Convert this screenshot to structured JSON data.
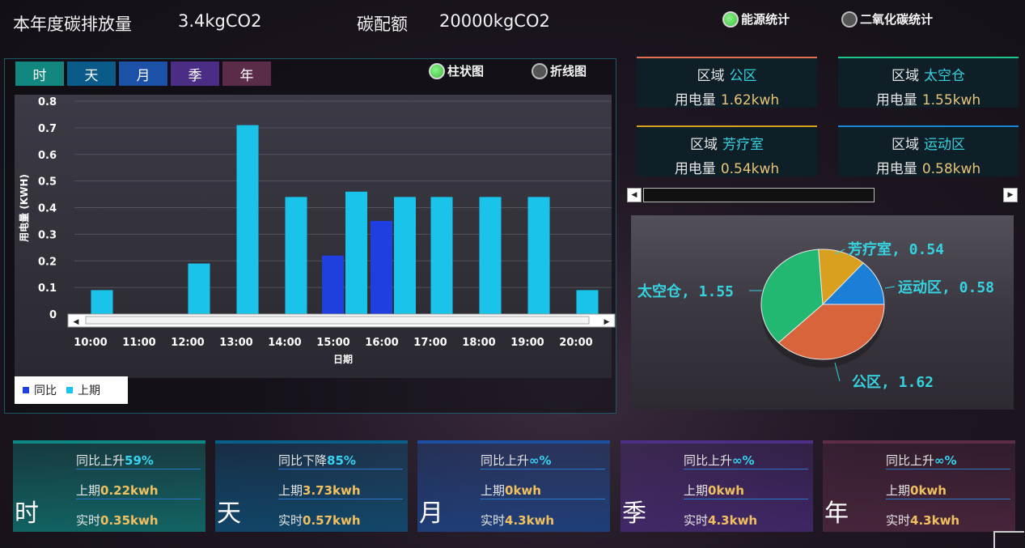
{
  "header": {
    "annual_label": "本年度碳排放量",
    "annual_value": "3.4kgCO2",
    "quota_label": "碳配额",
    "quota_value": "20000kgCO2",
    "radio_energy": "能源统计",
    "radio_co2": "二氧化碳统计"
  },
  "tabs": [
    {
      "label": "时",
      "color": "#12877f"
    },
    {
      "label": "天",
      "color": "#0a5a8a"
    },
    {
      "label": "月",
      "color": "#1b52a8"
    },
    {
      "label": "季",
      "color": "#4b2d85"
    },
    {
      "label": "年",
      "color": "#5a2c47"
    }
  ],
  "chart_type_toggle": {
    "bar": "柱状图",
    "line": "折线图"
  },
  "chart_data": {
    "type": "bar",
    "categories": [
      "10:00",
      "11:00",
      "12:00",
      "13:00",
      "14:00",
      "15:00",
      "16:00",
      "17:00",
      "18:00",
      "19:00",
      "20:00"
    ],
    "series": [
      {
        "name": "同比",
        "color": "#1f3fe0",
        "values": [
          null,
          null,
          null,
          null,
          null,
          0.22,
          0.35,
          null,
          null,
          null,
          null
        ]
      },
      {
        "name": "上期",
        "color": "#19c3ea",
        "values": [
          0.09,
          0,
          0.19,
          0.71,
          0.44,
          0.46,
          0.44,
          0.44,
          0.44,
          0.44,
          0.09
        ]
      }
    ],
    "yticks": [
      "0",
      "0.1",
      "0.2",
      "0.3",
      "0.4",
      "0.5",
      "0.6",
      "0.7",
      "0.8"
    ],
    "ylim": [
      0,
      0.8
    ],
    "xlabel": "日期",
    "ylabel": "用电量 (KWH)",
    "grid": true,
    "legend_position": "bottom-left"
  },
  "regions": [
    {
      "area_label": "区域",
      "area": "公区",
      "usage_label": "用电量",
      "usage": "1.62kwh",
      "color": "#e07050"
    },
    {
      "area_label": "区域",
      "area": "太空仓",
      "usage_label": "用电量",
      "usage": "1.55kwh",
      "color": "#1ec48a"
    },
    {
      "area_label": "区域",
      "area": "芳疗室",
      "usage_label": "用电量",
      "usage": "0.54kwh",
      "color": "#d9a020"
    },
    {
      "area_label": "区域",
      "area": "运动区",
      "usage_label": "用电量",
      "usage": "0.58kwh",
      "color": "#1b86d8"
    }
  ],
  "pie": {
    "slices": [
      {
        "name": "公区",
        "value": 1.62,
        "color": "#d8643c",
        "label": "公区, 1.62"
      },
      {
        "name": "太空仓",
        "value": 1.55,
        "color": "#23b872",
        "label": "太空仓, 1.55"
      },
      {
        "name": "芳疗室",
        "value": 0.54,
        "color": "#d9a020",
        "label": "芳疗室, 0.54"
      },
      {
        "name": "运动区",
        "value": 0.58,
        "color": "#1b7fd8",
        "label": "运动区, 0.58"
      }
    ]
  },
  "summary": [
    {
      "period": "时",
      "trend": "同比上升",
      "pct": "59%",
      "prev_label": "上期",
      "prev": "0.22kwh",
      "real_label": "实时",
      "real": "0.35kwh",
      "color": "#0e8a86"
    },
    {
      "period": "天",
      "trend": "同比下降",
      "pct": "85%",
      "prev_label": "上期",
      "prev": "3.73kwh",
      "real_label": "实时",
      "real": "0.57kwh",
      "color": "#0b5d8c"
    },
    {
      "period": "月",
      "trend": "同比上升",
      "pct": "∞%",
      "prev_label": "上期",
      "prev": "0kwh",
      "real_label": "实时",
      "real": "4.3kwh",
      "color": "#1c4fa0"
    },
    {
      "period": "季",
      "trend": "同比上升",
      "pct": "∞%",
      "prev_label": "上期",
      "prev": "0kwh",
      "real_label": "实时",
      "real": "4.3kwh",
      "color": "#4f2e86"
    },
    {
      "period": "年",
      "trend": "同比上升",
      "pct": "∞%",
      "prev_label": "上期",
      "prev": "0kwh",
      "real_label": "实时",
      "real": "4.3kwh",
      "color": "#5c2d47"
    }
  ]
}
